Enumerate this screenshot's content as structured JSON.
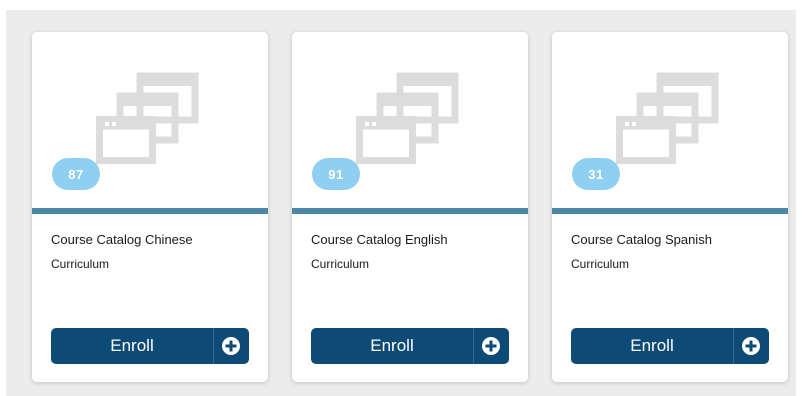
{
  "courses": [
    {
      "count": "87",
      "title": "Course Catalog Chinese",
      "subtitle": "Curriculum",
      "button_label": "Enroll",
      "image_icon": "stacked-windows-icon",
      "button_icon": "plus-circle-icon"
    },
    {
      "count": "91",
      "title": "Course Catalog English",
      "subtitle": "Curriculum",
      "button_label": "Enroll",
      "image_icon": "stacked-windows-icon",
      "button_icon": "plus-circle-icon"
    },
    {
      "count": "31",
      "title": "Course Catalog Spanish",
      "subtitle": "Curriculum",
      "button_label": "Enroll",
      "image_icon": "stacked-windows-icon",
      "button_icon": "plus-circle-icon"
    }
  ],
  "colors": {
    "badge": "#8fd0f2",
    "accent_bar": "#4d87a6",
    "button": "#0d4a75",
    "icon_gray": "#dcdcdc",
    "panel_background": "#ececec"
  }
}
